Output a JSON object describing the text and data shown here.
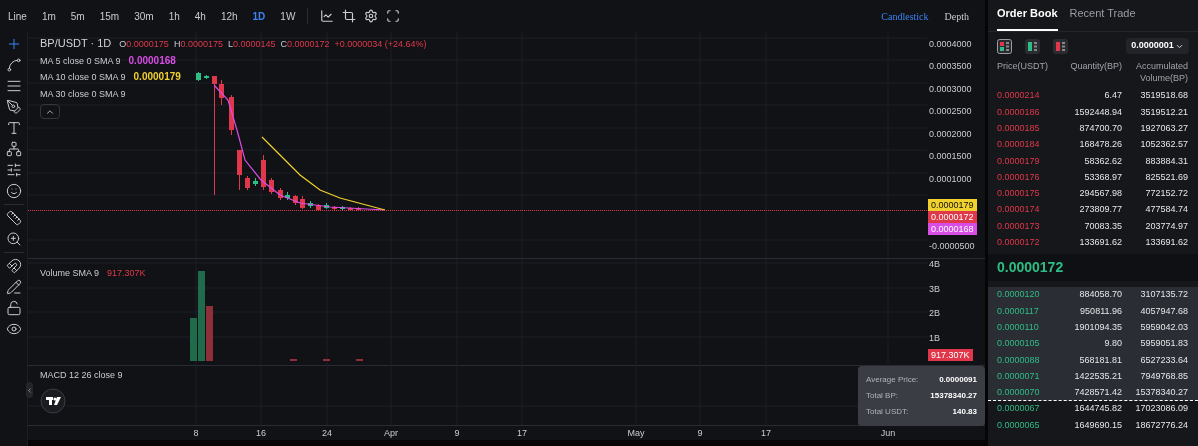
{
  "toolbar": {
    "intervals": [
      {
        "label": "Line",
        "selected": false
      },
      {
        "label": "1m",
        "selected": false
      },
      {
        "label": "5m",
        "selected": false
      },
      {
        "label": "15m",
        "selected": false
      },
      {
        "label": "30m",
        "selected": false
      },
      {
        "label": "1h",
        "selected": false
      },
      {
        "label": "4h",
        "selected": false
      },
      {
        "label": "12h",
        "selected": false
      },
      {
        "label": "1D",
        "selected": true
      },
      {
        "label": "1W",
        "selected": false
      }
    ],
    "chart_types": [
      {
        "label": "Candlestick",
        "selected": true
      },
      {
        "label": "Depth",
        "selected": false
      }
    ]
  },
  "drawing_tools": [
    {
      "kind": "crosshair",
      "selected": true
    },
    {
      "kind": "trend-line",
      "selected": false
    },
    {
      "kind": "horizontal-lines",
      "selected": false
    },
    {
      "kind": "brush",
      "selected": false
    },
    {
      "kind": "text",
      "selected": false
    },
    {
      "kind": "pattern",
      "selected": false
    },
    {
      "kind": "sliders",
      "selected": false
    },
    {
      "kind": "smiley",
      "selected": false
    },
    {
      "kind": "ruler",
      "selected": false
    },
    {
      "kind": "zoom",
      "selected": false
    },
    {
      "kind": "magnet",
      "selected": false
    },
    {
      "kind": "lock-drawing",
      "selected": false
    },
    {
      "kind": "lock",
      "selected": false
    },
    {
      "kind": "eye",
      "selected": false
    }
  ],
  "price_pane": {
    "symbol": "BP/USDT · 1D",
    "ohlc": [
      {
        "label": "O",
        "value": "0.0000175"
      },
      {
        "label": "H",
        "value": "0.0000175"
      },
      {
        "label": "L",
        "value": "0.0000145"
      },
      {
        "label": "C",
        "value": "0.0000172"
      }
    ],
    "change": "+0.0000034 (+24.64%)",
    "indicators": [
      {
        "label": "MA 5 close 0 SMA 9",
        "value": "0.0000168",
        "color": "#d84de6"
      },
      {
        "label": "MA 10 close 0 SMA 9",
        "value": "0.0000179",
        "color": "#f0d12e"
      },
      {
        "label": "MA 30 close 0 SMA 9"
      }
    ],
    "axis_ticks": [
      "0.0004000",
      "0.0003500",
      "0.0003000",
      "0.0002500",
      "0.0002000",
      "0.0001500",
      "0.0001000",
      "-0.0000500"
    ],
    "badges": [
      {
        "text": "0.0000179",
        "color": "#f0d12e"
      },
      {
        "text": "0.0000172",
        "color": "#e0384a"
      },
      {
        "text": "0.0000168",
        "color": "#d84de6"
      }
    ]
  },
  "volume_pane": {
    "label": "Volume SMA 9",
    "value": "917.307K",
    "axis_ticks": [
      "4B",
      "3B",
      "2B",
      "1B"
    ],
    "badge": "917.307K"
  },
  "macd_pane": {
    "label": "MACD 12 26 close 9"
  },
  "time_axis": [
    "8",
    "16",
    "24",
    "Apr",
    "9",
    "17",
    "May",
    "9",
    "17",
    "Jun"
  ],
  "order_book": {
    "tabs": [
      {
        "label": "Order Book",
        "selected": true
      },
      {
        "label": "Recent Trade",
        "selected": false
      }
    ],
    "views": [
      {
        "kind": "both",
        "selected": true
      },
      {
        "kind": "bids",
        "selected": false
      },
      {
        "kind": "asks",
        "selected": false
      }
    ],
    "precision": "0.0000001",
    "columns": [
      "Price(USDT)",
      "Quantity(BP)",
      "Accumulated Volume(BP)"
    ],
    "asks": [
      {
        "price": "0.0000214",
        "quantity": "6.47",
        "accumulated": "3519518.68"
      },
      {
        "price": "0.0000186",
        "quantity": "1592448.94",
        "accumulated": "3519512.21"
      },
      {
        "price": "0.0000185",
        "quantity": "874700.70",
        "accumulated": "1927063.27"
      },
      {
        "price": "0.0000184",
        "quantity": "168478.26",
        "accumulated": "1052362.57"
      },
      {
        "price": "0.0000179",
        "quantity": "58362.62",
        "accumulated": "883884.31"
      },
      {
        "price": "0.0000176",
        "quantity": "53368.97",
        "accumulated": "825521.69"
      },
      {
        "price": "0.0000175",
        "quantity": "294567.98",
        "accumulated": "772152.72"
      },
      {
        "price": "0.0000174",
        "quantity": "273809.77",
        "accumulated": "477584.74"
      },
      {
        "price": "0.0000173",
        "quantity": "70083.35",
        "accumulated": "203774.97"
      },
      {
        "price": "0.0000172",
        "quantity": "133691.62",
        "accumulated": "133691.62"
      }
    ],
    "last_price": "0.0000172",
    "bids": [
      {
        "price": "0.0000120",
        "quantity": "884058.70",
        "accumulated": "3107135.72",
        "highlighted": true
      },
      {
        "price": "0.0000117",
        "quantity": "950811.96",
        "accumulated": "4057947.68",
        "highlighted": true
      },
      {
        "price": "0.0000110",
        "quantity": "1901094.35",
        "accumulated": "5959042.03",
        "highlighted": true
      },
      {
        "price": "0.0000105",
        "quantity": "9.80",
        "accumulated": "5959051.83",
        "highlighted": true
      },
      {
        "price": "0.0000088",
        "quantity": "568181.81",
        "accumulated": "6527233.64",
        "highlighted": true
      },
      {
        "price": "0.0000071",
        "quantity": "1422535.21",
        "accumulated": "7949768.85",
        "highlighted": true
      },
      {
        "price": "0.0000070",
        "quantity": "7428571.42",
        "accumulated": "15378340.27",
        "highlighted": true
      },
      {
        "price": "0.0000067",
        "quantity": "1644745.82",
        "accumulated": "17023086.09",
        "highlighted": false
      },
      {
        "price": "0.0000065",
        "quantity": "1649690.15",
        "accumulated": "18672776.24",
        "highlighted": false
      }
    ],
    "tooltip": [
      {
        "label": "Average Price:",
        "value": "0.0000091"
      },
      {
        "label": "Total BP:",
        "value": "15378340.27"
      },
      {
        "label": "Total USDT:",
        "value": "140.83"
      }
    ]
  }
}
